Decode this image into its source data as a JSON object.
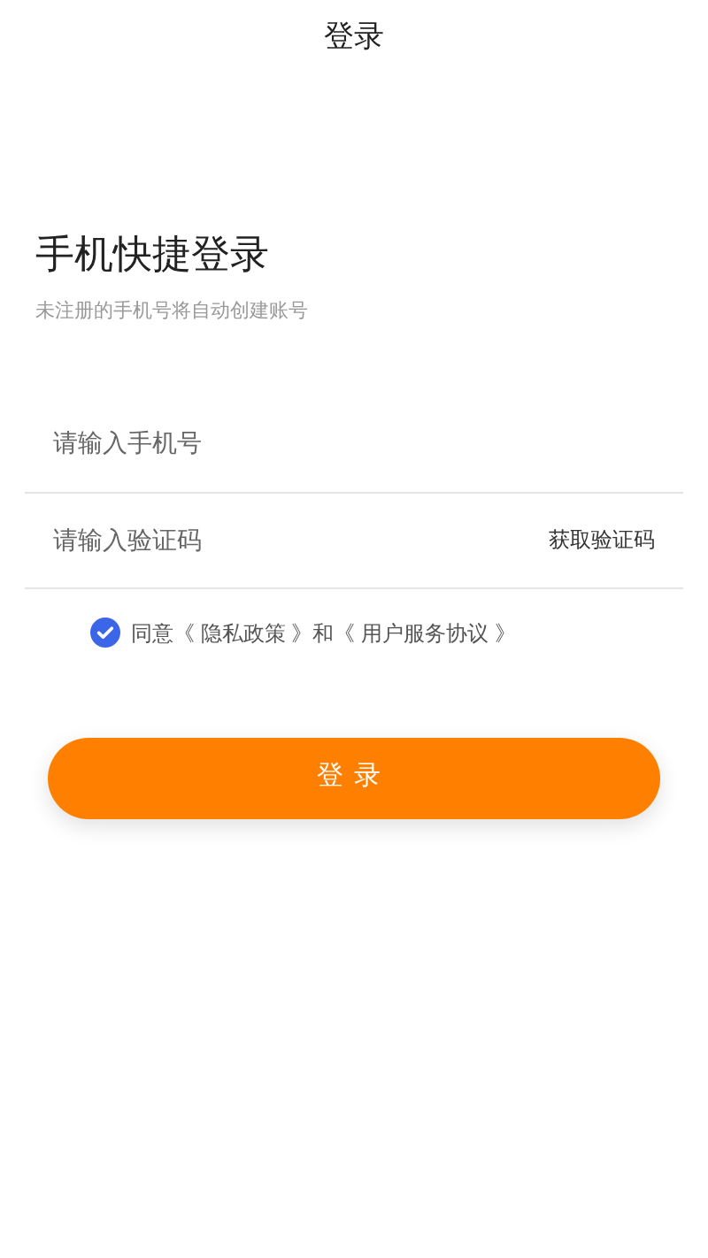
{
  "window": {
    "title": "登录"
  },
  "heading": "手机快捷登录",
  "subtitle": "未注册的手机号将自动创建账号",
  "phone_field": {
    "placeholder": "请输入手机号"
  },
  "code_field": {
    "placeholder": "请输入验证码",
    "action": "获取验证码"
  },
  "agreement": {
    "checked": true,
    "prefix": "同意",
    "links": [
      "《 隐私政策 》",
      "《 用户服务协议 》"
    ],
    "joiner": "和"
  },
  "login_button": "登录"
}
